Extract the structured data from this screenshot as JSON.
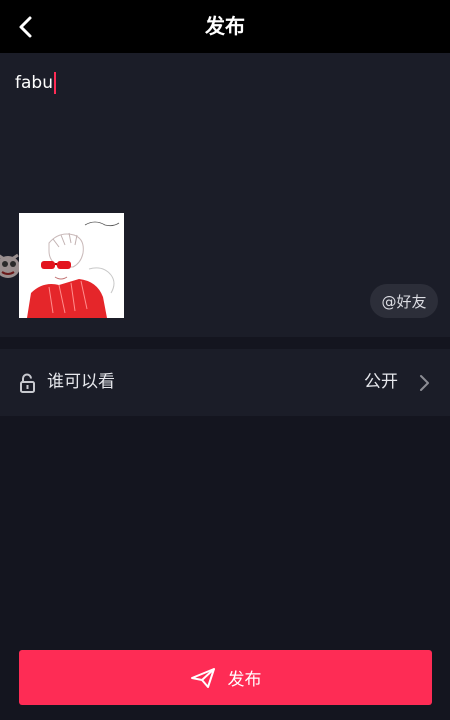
{
  "header": {
    "title": "发布",
    "back_icon": "chevron-left-icon"
  },
  "compose": {
    "caption_text": "fabu",
    "cursor_color": "#fe2c55",
    "mention_chip_label": "@好友",
    "thumbnail_icon": "video-cover-thumbnail"
  },
  "visibility": {
    "lock_icon": "unlock-icon",
    "label": "谁可以看",
    "value": "公开",
    "chevron_icon": "chevron-right-icon"
  },
  "publish_button": {
    "label": "发布",
    "icon": "paper-plane-icon"
  },
  "colors": {
    "accent": "#fe2c55",
    "background": "#14151f",
    "panel": "#1b1d28",
    "header": "#000000"
  }
}
